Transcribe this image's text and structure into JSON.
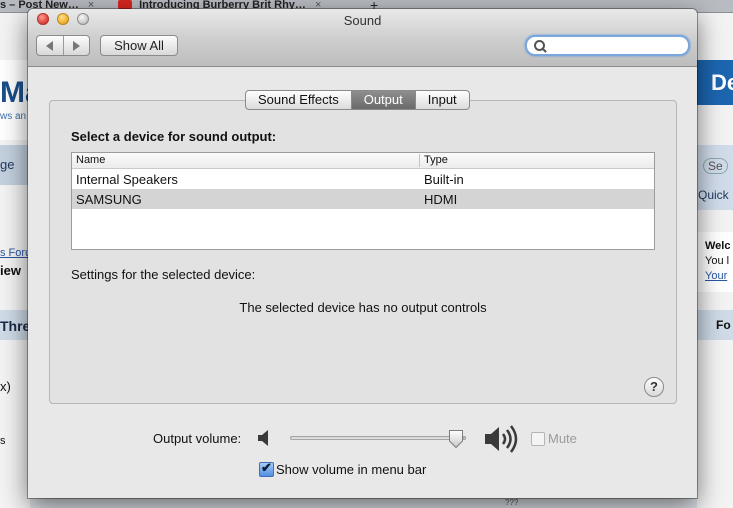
{
  "background": {
    "tabs": [
      "s – Post New…",
      "Introducing Burberry Brit Rhy…"
    ],
    "tab_close": "×",
    "new_tab": "+",
    "fragments": {
      "ma": "Ma",
      "ws": "ws an",
      "ge": "ge",
      "forum": "s Foru",
      "iew": "iew",
      "thre": "Thre",
      "x": "x)",
      "s": "s",
      "de": "De",
      "search": "Se",
      "quick": "Quick",
      "welc": "Welc",
      "you": "You l",
      "your": "Your",
      "fo": "Fo",
      "q": "???"
    }
  },
  "window": {
    "title": "Sound",
    "show_all": "Show All",
    "search_value": ""
  },
  "tabs": [
    {
      "label": "Sound Effects",
      "active": false
    },
    {
      "label": "Output",
      "active": true
    },
    {
      "label": "Input",
      "active": false
    }
  ],
  "output": {
    "heading": "Select a device for sound output:",
    "columns": {
      "name": "Name",
      "type": "Type"
    },
    "devices": [
      {
        "name": "Internal Speakers",
        "type": "Built-in",
        "selected": false
      },
      {
        "name": "SAMSUNG",
        "type": "HDMI",
        "selected": true
      }
    ],
    "settings_label": "Settings for the selected device:",
    "no_controls": "The selected device has no output controls",
    "help": "?"
  },
  "volume": {
    "label": "Output volume:",
    "level_fraction": 0.99,
    "mute_label": "Mute",
    "mute_checked": false,
    "show_in_menubar_label": "Show volume in menu bar",
    "show_in_menubar_checked": true,
    "checkmark": "✔"
  }
}
